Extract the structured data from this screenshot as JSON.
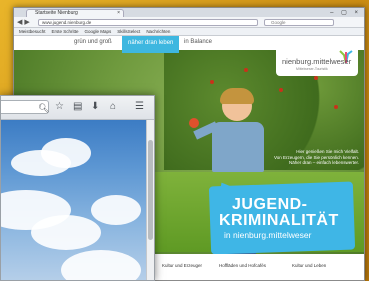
{
  "back_window": {
    "tab_title": "Startseite Nienburg",
    "url": "www.jugend.nienburg.de",
    "search_placeholder": "Google",
    "bookmarks": [
      "Meistbesucht",
      "Erste Schritte",
      "Google Maps",
      "SkillsSelect",
      "Nachrichten"
    ],
    "site": {
      "nav": [
        "grün und groß",
        "näher dran leben",
        "in Balance"
      ],
      "active_nav": "näher dran leben",
      "logo": "nienburg.mittelweser",
      "logo_sub": "Mittelweser-Touristik",
      "quote_lines": [
        "Hier genießen Sie mich Vielfalt.",
        "Von Erzeugern, die Sie persönlich kennen.",
        "Näher dran – einfach lebenswerter."
      ],
      "headline_1": "JUGEND-",
      "headline_2": "KRIMINALITÄT",
      "headline_3": "in nienburg.mittelweser",
      "footer_items": [
        "Kultur und Erzeuger",
        "Hoffläden und Hofcafés",
        "Kultur und Leben"
      ]
    }
  },
  "front_window": {
    "icons": [
      "search-icon",
      "star-icon",
      "clipboard-icon",
      "download-icon",
      "home-icon",
      "menu-icon"
    ]
  },
  "colors": {
    "accent": "#3fb6e6",
    "desktop": "#d9a21a"
  }
}
